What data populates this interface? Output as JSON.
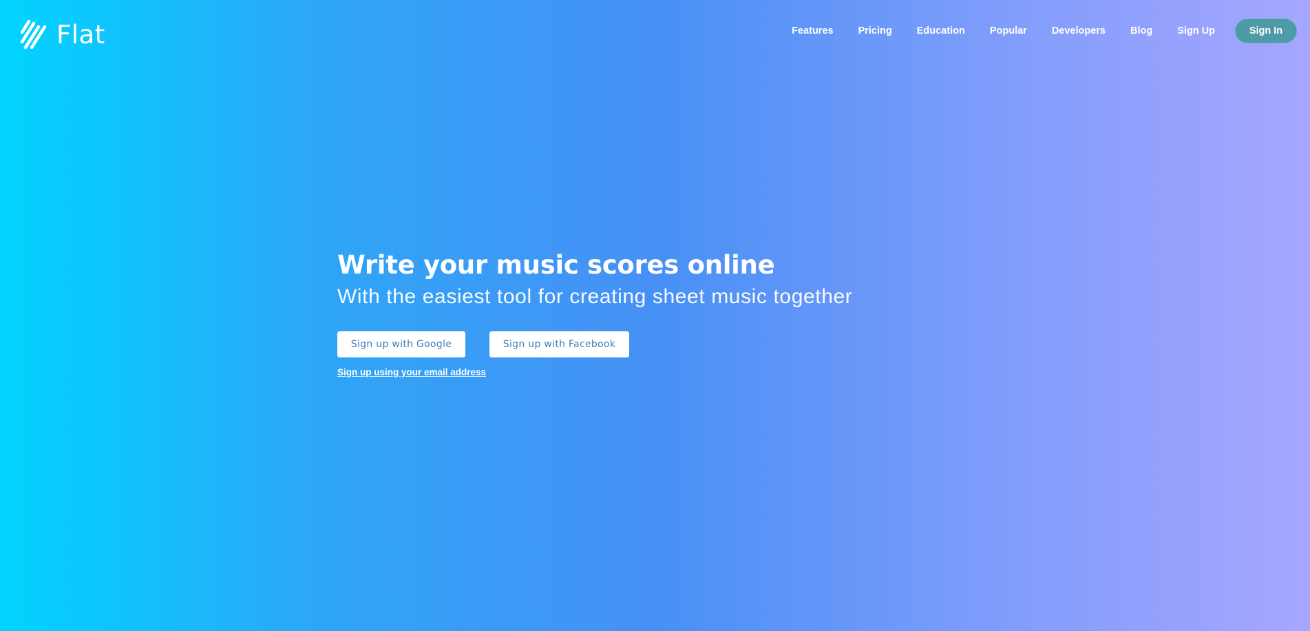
{
  "brand": {
    "name": "Flat",
    "logo_icon": "flat-stripes-logo-icon"
  },
  "nav": {
    "items": [
      {
        "label": "Features"
      },
      {
        "label": "Pricing"
      },
      {
        "label": "Education"
      },
      {
        "label": "Popular"
      },
      {
        "label": "Developers"
      },
      {
        "label": "Blog"
      },
      {
        "label": "Sign Up"
      }
    ],
    "signin_label": "Sign In"
  },
  "hero": {
    "title": "Write your music scores online",
    "subtitle": "With the easiest tool for creating sheet music together",
    "google_button": "Sign up with Google",
    "facebook_button": "Sign up with Facebook",
    "email_link": "Sign up using your email address"
  },
  "colors": {
    "gradient_start": "#00d4ff",
    "gradient_mid": "#4790f5",
    "gradient_end": "#a6a6ff",
    "signin_bg": "#4e9aa6",
    "button_text": "#3e7db8"
  }
}
